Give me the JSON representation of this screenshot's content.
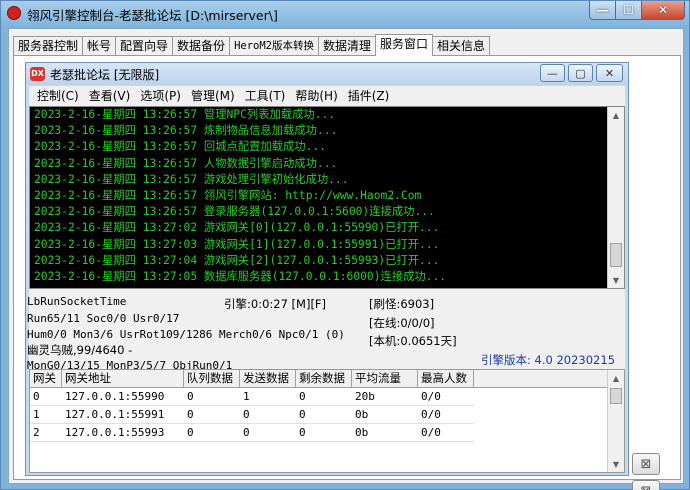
{
  "outer": {
    "title": "翎风引擎控制台-老瑟批论坛 [D:\\mirserver\\]",
    "min_label": "—",
    "max_label": "☐",
    "close_label": "✕"
  },
  "tabs": [
    "服务器控制",
    "帐号",
    "配置向导",
    "数据备份",
    "HeroM2版本转换",
    "数据清理",
    "服务窗口",
    "相关信息"
  ],
  "inner": {
    "icon_text": "DX",
    "title": "老瑟批论坛 [无限版]",
    "min_label": "—",
    "max_label": "▢",
    "close_label": "✕"
  },
  "menu": [
    "控制(C)",
    "查看(V)",
    "选项(P)",
    "管理(M)",
    "工具(T)",
    "帮助(H)",
    "插件(Z)"
  ],
  "log_lines": [
    "2023-2-16-星期四 13:26:57 管理NPC列表加载成功...",
    "2023-2-16-星期四 13:26:57 炼制物品信息加载成功...",
    "2023-2-16-星期四 13:26:57 回城点配置加载成功...",
    "2023-2-16-星期四 13:26:57 人物数据引擎启动成功...",
    "2023-2-16-星期四 13:26:57 游戏处理引擎初始化成功...",
    "2023-2-16-星期四 13:26:57 翎风引擎网站: http://www.Haom2.Com",
    "2023-2-16-星期四 13:26:57 登录服务器(127.0.0.1:5600)连接成功...",
    "2023-2-16-星期四 13:27:02 游戏网关[0](127.0.0.1:55990)已打开...",
    "2023-2-16-星期四 13:27:03 游戏网关[1](127.0.0.1:55991)已打开...",
    "2023-2-16-星期四 13:27:04 游戏网关[2](127.0.0.1:55993)已打开...",
    "2023-2-16-星期四 13:27:05 数据库服务器(127.0.0.1:6000)连接成功..."
  ],
  "status": {
    "run_socket_time": "LbRunSocketTime",
    "run_line": "Run65/11 Soc0/0 Usr0/17",
    "hum_line": "Hum0/0 Mon3/6 UsrRot109/1286 Merch0/6 Npc0/1 (0)",
    "monster_line": "幽灵乌贼,99/4640 -",
    "mon_line": "MonG0/13/15 MonP3/5/7 ObjRun0/1",
    "engine_time": "引擎:0:0:27 [M][F]",
    "refresh": "[刷怪:6903]",
    "online": "[在线:0/0/0]",
    "local": "[本机:0.0651天]",
    "engine_version": "引擎版本: 4.0 20230215"
  },
  "grid": {
    "headers": [
      "网关",
      "网关地址",
      "队列数据",
      "发送数据",
      "剩余数据",
      "平均流量",
      "最高人数"
    ],
    "rows": [
      [
        "0",
        "127.0.0.1:55990",
        "0",
        "1",
        "0",
        "20b",
        "0/0"
      ],
      [
        "1",
        "127.0.0.1:55991",
        "0",
        "0",
        "0",
        "0b",
        "0/0"
      ],
      [
        "2",
        "127.0.0.1:55993",
        "0",
        "0",
        "0",
        "0b",
        "0/0"
      ]
    ]
  },
  "side_buttons": [
    "⊠",
    "⊠"
  ]
}
